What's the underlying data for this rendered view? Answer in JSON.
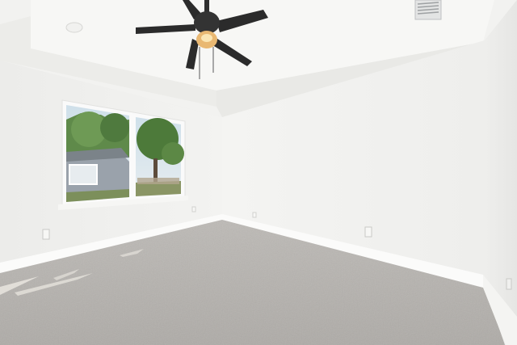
{
  "scene": {
    "room": "empty-bedroom",
    "fixtures": [
      "ceiling-fan",
      "window",
      "hvac-vent",
      "electrical-outlet",
      "baseboard",
      "carpet"
    ],
    "colors": {
      "wall": "#f2f2f0",
      "ceiling": "#f6f6f4",
      "carpet": "#b9b6b2",
      "fan_blade": "#2b2b2b",
      "sunlight": "#ece9e2"
    }
  }
}
